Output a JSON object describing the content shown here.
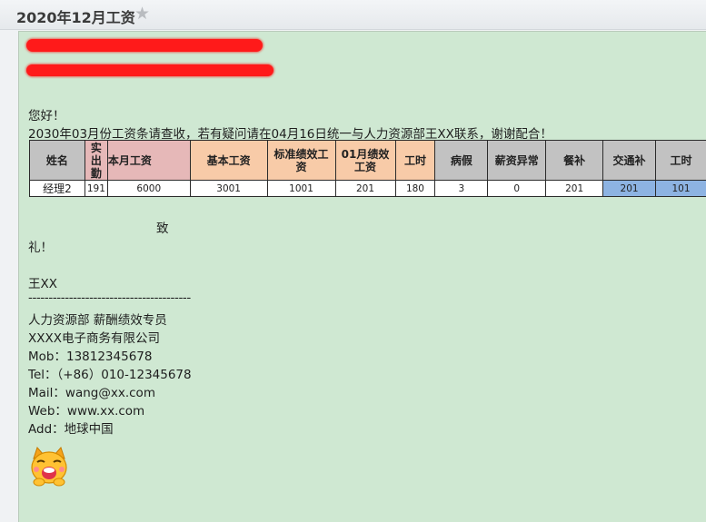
{
  "subject": "2020年12月工资",
  "greeting": "您好！",
  "intro": "2030年03月份工资条请查收，若有疑问请在04月16日统一与人力资源部王XX联系，谢谢配合！",
  "table": {
    "headers": [
      "姓名",
      "实出勤",
      "本月工资",
      "基本工资",
      "标准绩效工资",
      "01月绩效工资",
      "工时",
      "病假",
      "薪资异常",
      "餐补",
      "交通补",
      "工时"
    ],
    "row": [
      "经理2",
      "191",
      "6000",
      "3001",
      "1001",
      "201",
      "180",
      "3",
      "0",
      "201",
      "201",
      "101"
    ]
  },
  "closing_zhi": "致",
  "closing_li": "礼！",
  "sender_name": "王XX",
  "divider": "----------------------------------------",
  "signature": [
    "人力资源部 薪酬绩效专员",
    "XXXX电子商务有限公司",
    "Mob：13812345678",
    "Tel：（+86）010-12345678",
    "Mail：wang@xx.com",
    "Web：www.xx.com",
    "Add：地球中国"
  ],
  "colors": {
    "header_gray": "#c2c2c2",
    "pink": "#e6b8b8",
    "peach": "#f8cba8",
    "blue": "#8db3e2",
    "body_bg": "#cfe8d2"
  },
  "icons": {
    "star": "star-icon",
    "avatar": "cat-emoji-avatar"
  }
}
